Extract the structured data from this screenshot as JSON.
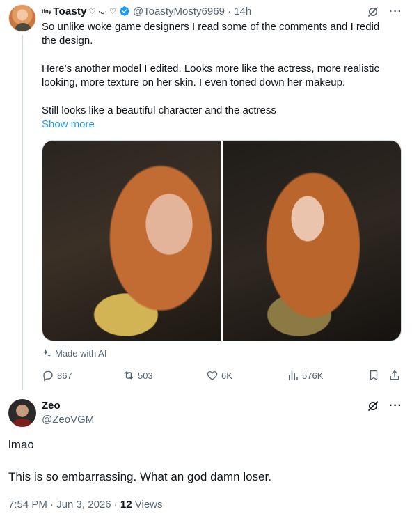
{
  "tweet": {
    "author": {
      "tiny_prefix": "tiny",
      "display_name": "Toasty",
      "decorations": "♡ ·ᴗ· ♡",
      "handle": "@ToastyMosty6969",
      "time": "14h",
      "verified": true
    },
    "paragraphs": [
      "So unlike woke game designers I read some of the comments and I redid the design.",
      "Here’s another model I edited. Looks more like the actress, more realistic looking, more texture on her skin. I even toned down her makeup.",
      "Still looks like a beautiful character and the actress"
    ],
    "show_more": "Show more",
    "media_label": "Made with AI",
    "actions": {
      "replies": "867",
      "reposts": "503",
      "likes": "6K",
      "views": "576K"
    }
  },
  "reply": {
    "author": {
      "display_name": "Zeo",
      "handle": "@ZeoVGM"
    },
    "paragraphs": [
      "lmao",
      "This is so embarrassing. What an god damn loser."
    ],
    "time": "7:54 PM · Jun 3, 2026 · ",
    "views_count": "12",
    "views_label": " Views"
  },
  "colors": {
    "text": "#0f1419",
    "secondary": "#536471",
    "link": "#1d9bf0",
    "thread_line": "#cfd9de"
  }
}
